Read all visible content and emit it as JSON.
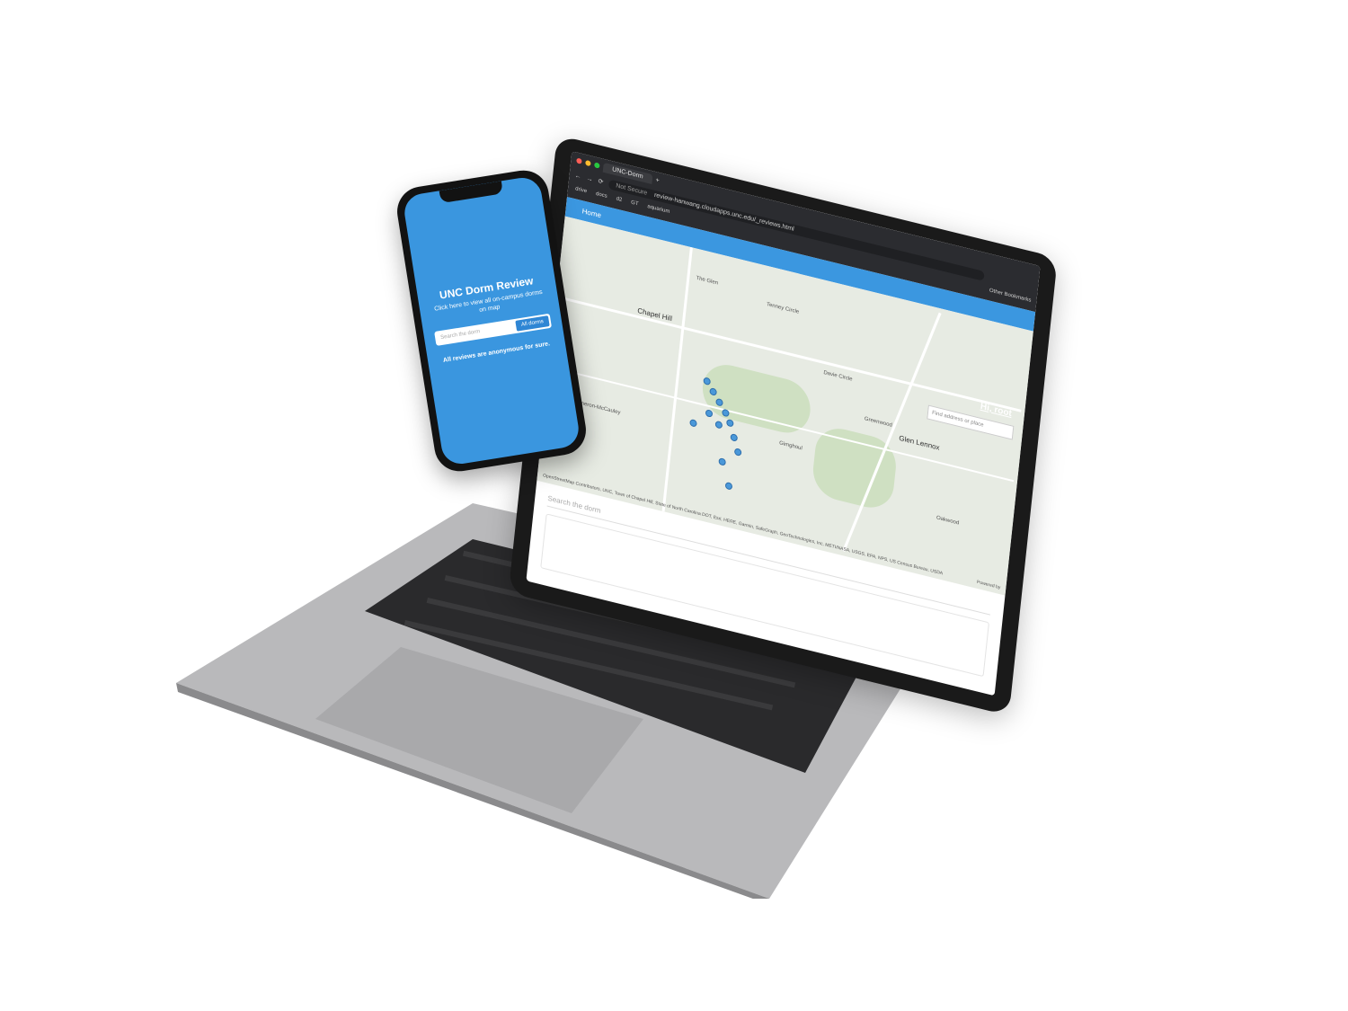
{
  "browser": {
    "tab_title": "UNC-Dorm",
    "url_warning": "Not Secure",
    "url": "review-hanwang.cloudapps.unc.edu/_reviews.html",
    "bookmarks": [
      "drive",
      "docs",
      "d2",
      "GT",
      "aquarium"
    ],
    "other_bookmarks": "Other Bookmarks"
  },
  "app": {
    "nav_home": "Home",
    "greeting": "Hi, root",
    "find_placeholder": "Find address or place",
    "search_placeholder": "Search the dorm",
    "attribution": "OpenStreetMap Contributors, UNC, Town of Chapel Hill, State of North Carolina DOT, Esri, HERE, Garmin, SafeGraph, GeoTechnologies, Inc, METI/NASA, USGS, EPA, NPS, US Census Bureau, USDA",
    "powered_by": "Powered by"
  },
  "map_labels": {
    "chapel_hill": "Chapel Hill",
    "glen_lennox": "Glen Lennox",
    "tenney_circle": "Tenney Circle",
    "davie_circle": "Davie Circle",
    "greenwood": "Greenwood",
    "the_glen": "The Glen",
    "gimghoul": "Gimghoul",
    "oakwood": "Oakwood",
    "cameron_mccauley": "Cameron-McCauley"
  },
  "phone": {
    "title": "UNC Dorm Review",
    "subtitle": "Click here to view all on-campus dorms on map",
    "search_placeholder": "Search the dorm",
    "all_dorms_button": "All dorms",
    "footer": "All reviews are anonymous for sure."
  },
  "colors": {
    "brand_blue": "#3a96df",
    "pin_blue": "#4a98d9"
  }
}
